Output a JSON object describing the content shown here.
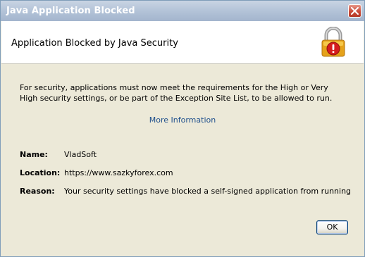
{
  "window": {
    "title": "Java Application Blocked",
    "close_icon": "close-icon"
  },
  "header": {
    "title": "Application Blocked by Java Security",
    "icon": "lock-warning-icon"
  },
  "message": {
    "description": "For security, applications must now meet the requirements for the High or Very High security settings, or be part of the Exception Site List, to be allowed to run.",
    "more_info": "More Information"
  },
  "details": {
    "name_label": "Name:",
    "name_value": "VladSoft",
    "location_label": "Location:",
    "location_value": "https://www.sazkyforex.com",
    "reason_label": "Reason:",
    "reason_value": "Your security settings have blocked a self-signed application from running"
  },
  "buttons": {
    "ok_label": "OK"
  },
  "colors": {
    "link": "#1e4f8c",
    "panel": "#ece9d8",
    "titlebar": "#b3c3d8",
    "close": "#c94a38"
  }
}
